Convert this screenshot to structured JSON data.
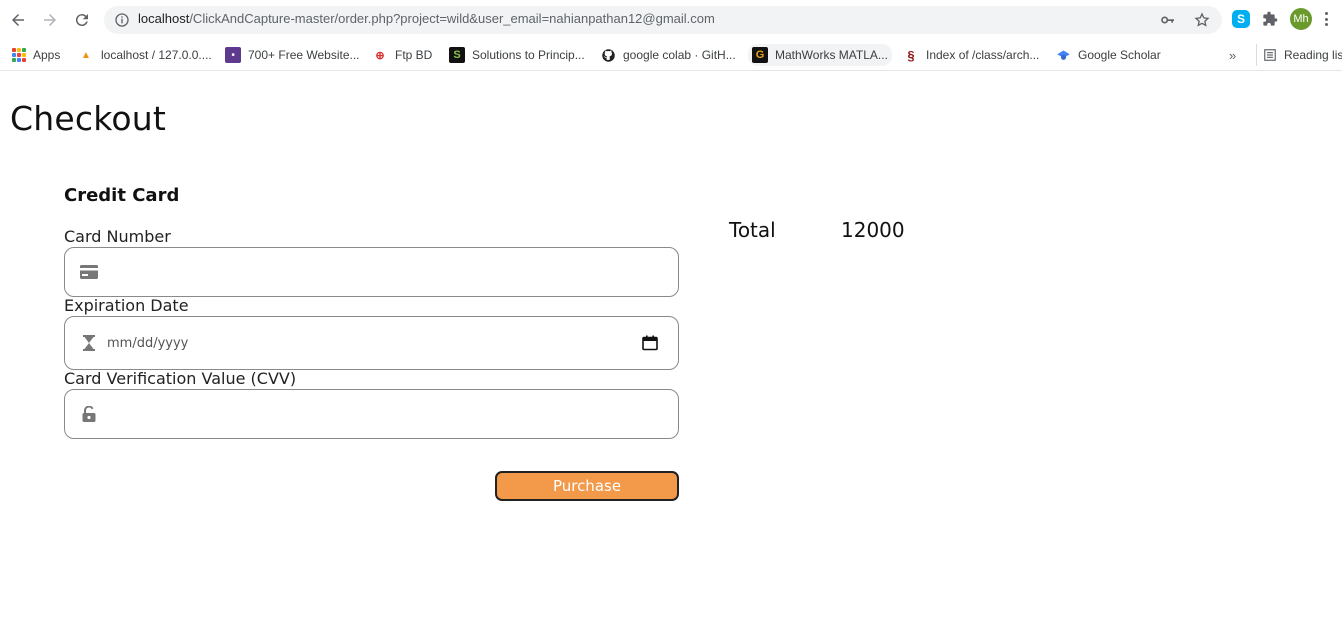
{
  "browser": {
    "url_host": "localhost",
    "url_path": "/ClickAndCapture-master/order.php?project=wild&user_email=nahianpathan12@gmail.com",
    "avatar_initials": "Mh",
    "skype_letter": "S"
  },
  "bookmarks": [
    {
      "label": "Apps",
      "icon": "apps-grid-icon"
    },
    {
      "label": "localhost / 127.0.0....",
      "icon": "phpmyadmin-icon"
    },
    {
      "label": "700+ Free Website...",
      "icon": "colorlib-icon"
    },
    {
      "label": "Ftp BD",
      "icon": "ftpbd-icon"
    },
    {
      "label": "Solutions to Princip...",
      "icon": "s-icon"
    },
    {
      "label": "google colab · GitH...",
      "icon": "github-icon"
    },
    {
      "label": "MathWorks MATLA...",
      "icon": "g-icon"
    },
    {
      "label": "Index of /class/arch...",
      "icon": "stanford-icon"
    },
    {
      "label": "Google Scholar",
      "icon": "scholar-icon"
    }
  ],
  "reading_list": "Reading lis",
  "page": {
    "title": "Checkout",
    "section_title": "Credit Card",
    "card_number_label": "Card Number",
    "expiration_label": "Expiration Date",
    "expiration_placeholder": "mm/dd/yyyy",
    "cvv_label": "Card Verification Value (CVV)",
    "purchase_label": "Purchase",
    "total_label": "Total",
    "total_value": "12000"
  },
  "colors": {
    "purchase_button": "#f2994a",
    "field_border": "#8a8a8a"
  }
}
